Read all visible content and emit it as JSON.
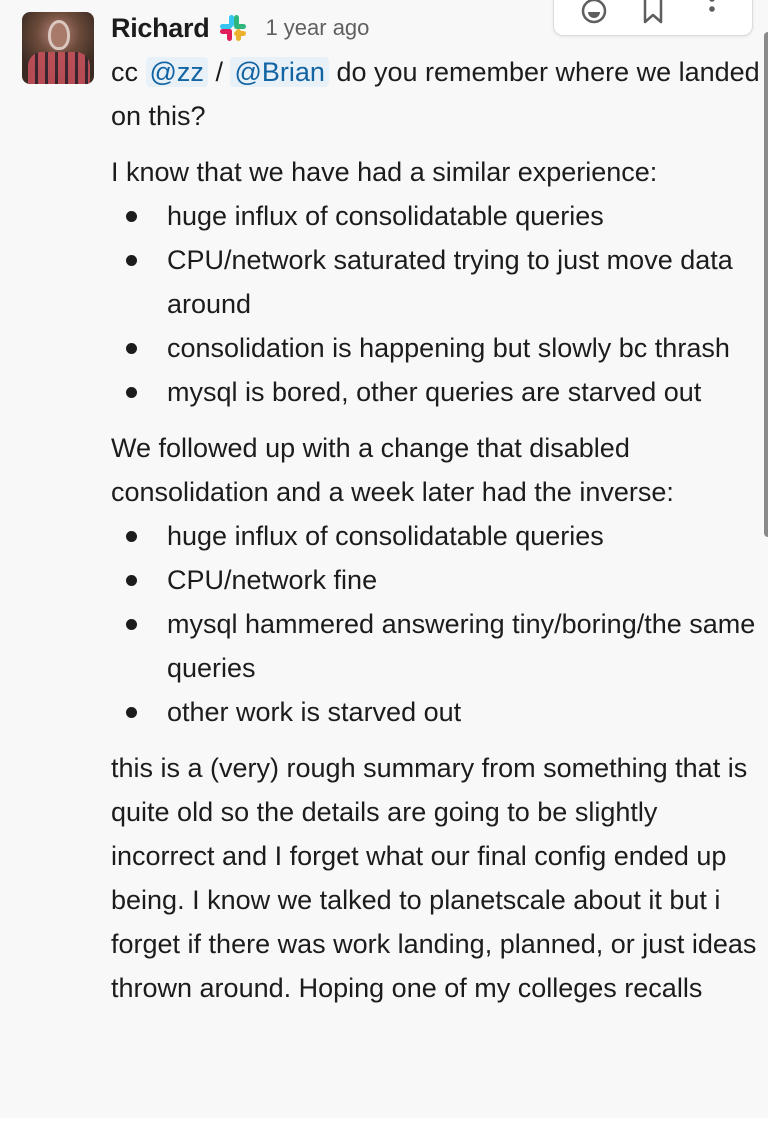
{
  "message": {
    "author": "Richard",
    "author_badge_icon": "slack-logo-icon",
    "timestamp": "1 year ago",
    "avatar_alt": "Richard avatar",
    "intro": {
      "prefix": "cc",
      "mention_1": "@zz",
      "separator": "/",
      "mention_2": "@Brian",
      "suffix": "do you remember where we landed on this?"
    },
    "section_1": {
      "lead": "I know that we have had a similar experience:",
      "bullets": [
        "huge influx of consolidatable queries",
        "CPU/network saturated trying to just move data around",
        "consolidation is happening but slowly bc thrash",
        "mysql is bored, other queries are starved out"
      ]
    },
    "section_2": {
      "lead": "We followed up with a change that disabled consolidation and a week later had the inverse:",
      "bullets": [
        "huge influx of consolidatable queries",
        "CPU/network fine",
        "mysql hammered answering tiny/boring/the same queries",
        "other work is starved out"
      ]
    },
    "closing": "this is a (very) rough summary from something that is quite old so the details are going to be slightly incorrect and I forget what our final config ended up being. I know we talked to planetscale about it but i forget if there was work landing, planned, or just ideas thrown around. Hoping one of my colleges recalls"
  },
  "toolbar": {
    "buttons": [
      {
        "icon": "add-reaction-icon",
        "label": "Add reaction"
      },
      {
        "icon": "bookmark-icon",
        "label": "Save for later"
      },
      {
        "icon": "more-actions-icon",
        "label": "More actions"
      }
    ]
  },
  "colors": {
    "mention_text": "#1264a3",
    "mention_bg": "#e8f0f8",
    "message_bg": "#f8f8f8",
    "timestamp": "#616061"
  }
}
